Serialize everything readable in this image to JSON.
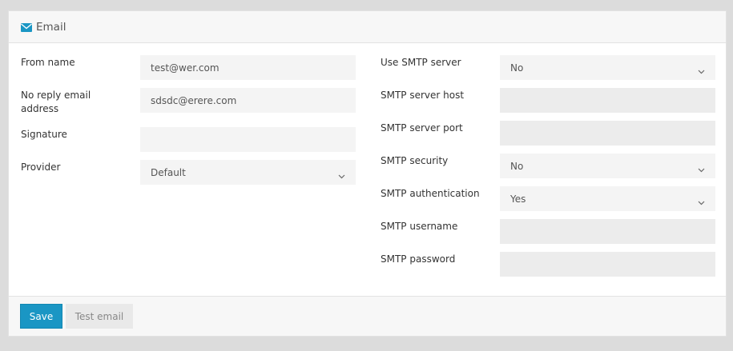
{
  "panel": {
    "title": "Email",
    "icon": "envelope-icon"
  },
  "left_fields": [
    {
      "label": "From name",
      "value": "test@wer.com",
      "type": "input"
    },
    {
      "label": "No reply email address",
      "value": "sdsdc@erere.com",
      "type": "input"
    },
    {
      "label": "Signature",
      "value": "",
      "type": "input"
    },
    {
      "label": "Provider",
      "value": "Default",
      "type": "select"
    }
  ],
  "right_fields": [
    {
      "label": "Use SMTP server",
      "value": "No",
      "type": "select"
    },
    {
      "label": "SMTP server host",
      "value": "",
      "type": "input"
    },
    {
      "label": "SMTP server port",
      "value": "",
      "type": "input"
    },
    {
      "label": "SMTP security",
      "value": "No",
      "type": "select"
    },
    {
      "label": "SMTP authentication",
      "value": "Yes",
      "type": "select"
    },
    {
      "label": "SMTP username",
      "value": "",
      "type": "input"
    },
    {
      "label": "SMTP password",
      "value": "",
      "type": "input"
    }
  ],
  "footer": {
    "save_label": "Save",
    "test_label": "Test email"
  },
  "colors": {
    "accent": "#1a96c4",
    "field_bg": "#f4f4f4",
    "page_bg": "#dcdcdc"
  }
}
